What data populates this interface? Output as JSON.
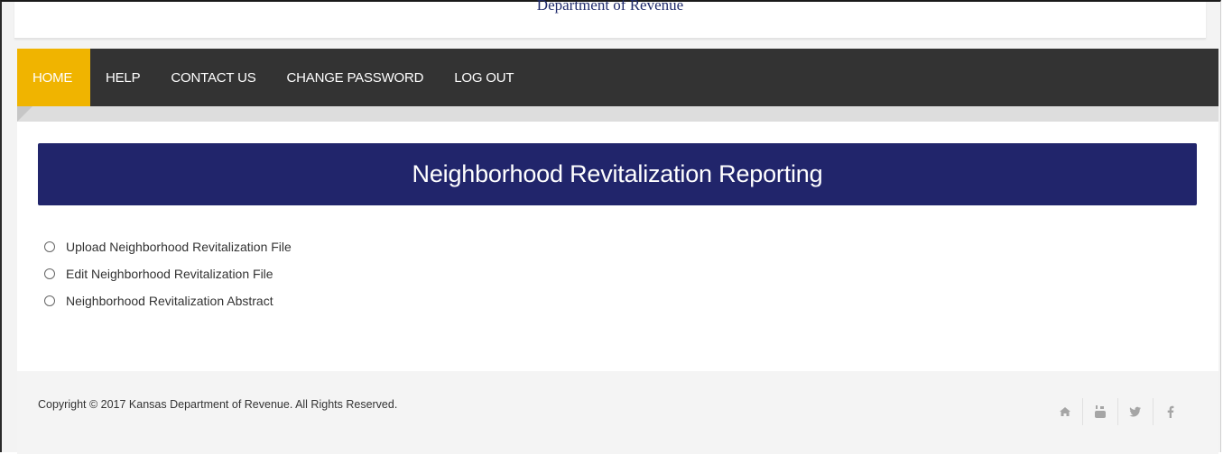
{
  "header": {
    "department": "Department of Revenue"
  },
  "nav": {
    "items": [
      {
        "label": "HOME",
        "active": true
      },
      {
        "label": "HELP"
      },
      {
        "label": "CONTACT US"
      },
      {
        "label": "CHANGE PASSWORD"
      },
      {
        "label": "LOG OUT"
      }
    ]
  },
  "main": {
    "title": "Neighborhood Revitalization Reporting",
    "options": [
      {
        "label": "Upload Neighborhood Revitalization File",
        "selected": false
      },
      {
        "label": "Edit Neighborhood Revitalization File",
        "selected": false
      },
      {
        "label": "Neighborhood Revitalization Abstract",
        "selected": false
      }
    ]
  },
  "footer": {
    "copyright": "Copyright © 2017 Kansas Department of Revenue. All Rights Reserved.",
    "social": [
      "home-icon",
      "youtube-icon",
      "twitter-icon",
      "facebook-icon"
    ]
  },
  "colors": {
    "accent": "#f0b400",
    "nav_bg": "#333333",
    "banner_bg": "#21256b"
  }
}
